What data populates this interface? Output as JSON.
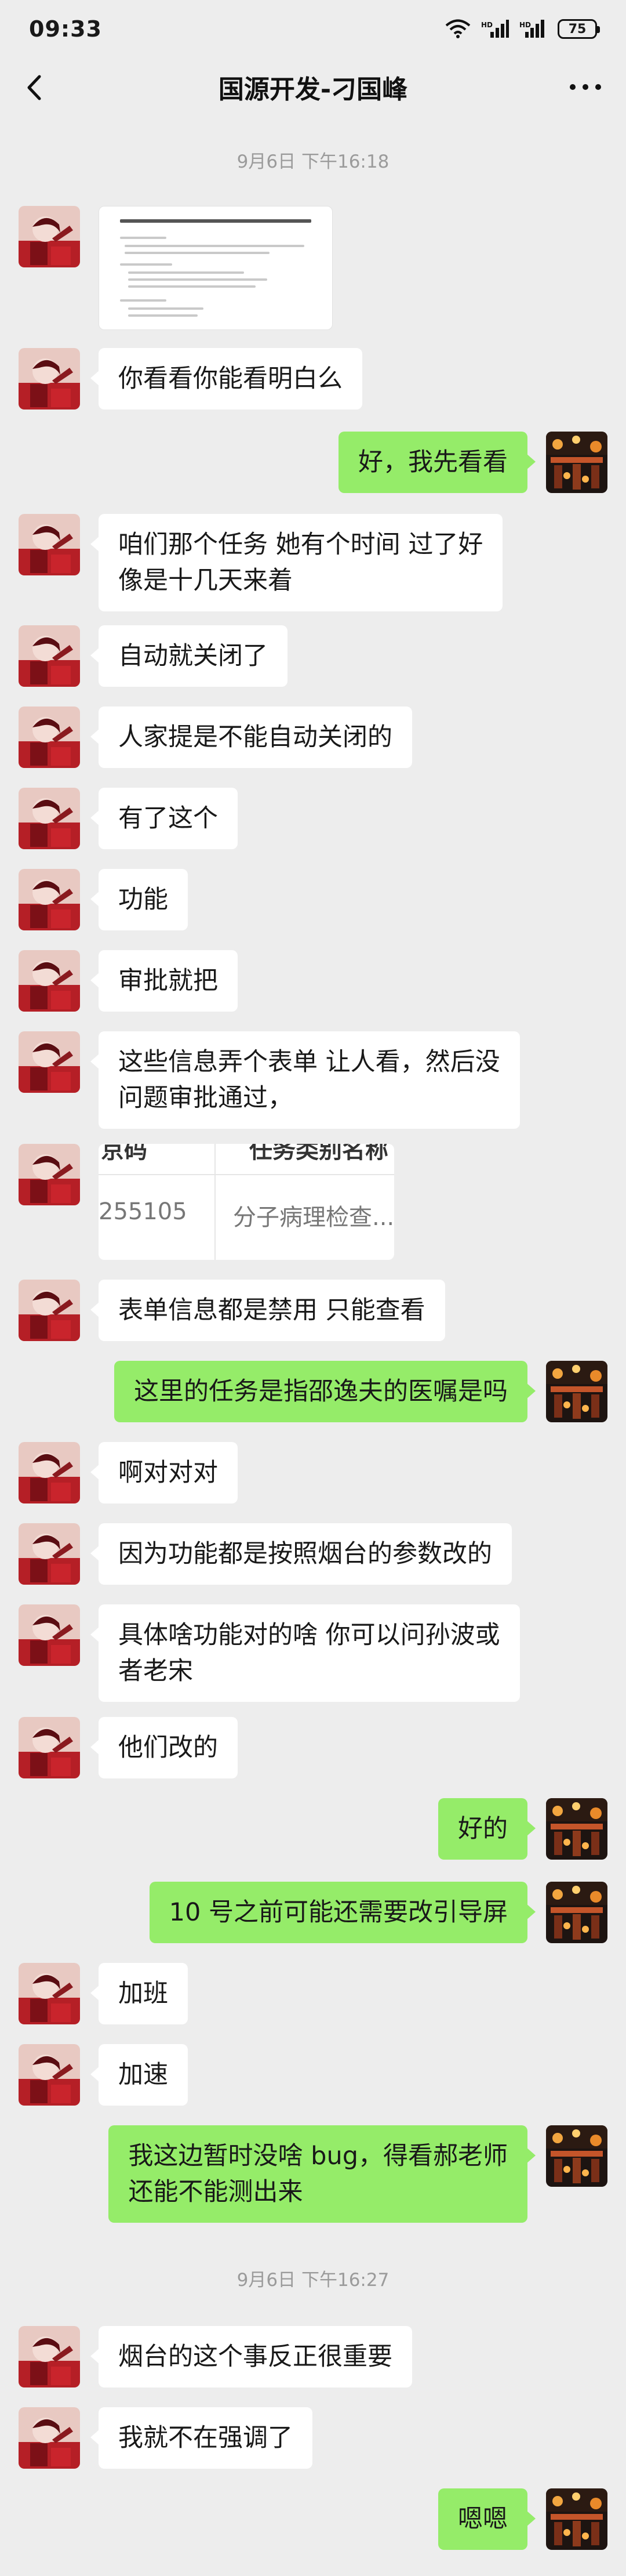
{
  "status_bar": {
    "time": "09:33",
    "battery": "75",
    "icons": [
      "wifi-icon",
      "signal-hd-icon",
      "signal-icon",
      "battery-icon"
    ]
  },
  "nav": {
    "title": "国源开发-刁国峰",
    "back_icon": "back-arrow-icon",
    "more_icon": "more-dots-icon"
  },
  "colors": {
    "background": "#ededed",
    "bubble_self": "#95ec69",
    "bubble_other": "#ffffff",
    "timestamp": "#9b9b9b"
  },
  "timestamps": [
    "9月6日 下午16:18",
    "9月6日 下午16:27"
  ],
  "messages": [
    {
      "side": "left",
      "type": "image",
      "image": "document-screenshot"
    },
    {
      "side": "left",
      "text": "你看看你能看明白么"
    },
    {
      "side": "right",
      "text": "好，我先看看"
    },
    {
      "side": "left",
      "text": "咱们那个任务 她有个时间 过了好\n像是十几天来着"
    },
    {
      "side": "left",
      "text": "自动就关闭了"
    },
    {
      "side": "left",
      "text": "人家提是不能自动关闭的"
    },
    {
      "side": "left",
      "text": "有了这个"
    },
    {
      "side": "left",
      "text": "功能"
    },
    {
      "side": "left",
      "text": "审批就把"
    },
    {
      "side": "left",
      "text": "这些信息弄个表单 让人看，然后没\n问题审批通过，"
    },
    {
      "side": "left",
      "type": "image",
      "image": "table-screenshot",
      "table": {
        "header_left": "京码",
        "header_right": "任务类别名称",
        "cell_left": "255105",
        "cell_right": "分子病理检查..."
      }
    },
    {
      "side": "left",
      "text": "表单信息都是禁用 只能查看"
    },
    {
      "side": "right",
      "text": "这里的任务是指邵逸夫的医嘱是吗"
    },
    {
      "side": "left",
      "text": "啊对对对"
    },
    {
      "side": "left",
      "text": "因为功能都是按照烟台的参数改的"
    },
    {
      "side": "left",
      "text": "具体啥功能对的啥 你可以问孙波或\n者老宋"
    },
    {
      "side": "left",
      "text": "他们改的"
    },
    {
      "side": "right",
      "text": "好的"
    },
    {
      "side": "right",
      "text": "10 号之前可能还需要改引导屏"
    },
    {
      "side": "left",
      "text": "加班"
    },
    {
      "side": "left",
      "text": "加速"
    },
    {
      "side": "right",
      "text": "我这边暂时没啥 bug，得看郝老师\n还能不能测出来"
    },
    {
      "side": "left",
      "text": "烟台的这个事反正很重要"
    },
    {
      "side": "left",
      "text": "我就不在强调了"
    },
    {
      "side": "right",
      "text": "嗯嗯"
    }
  ]
}
